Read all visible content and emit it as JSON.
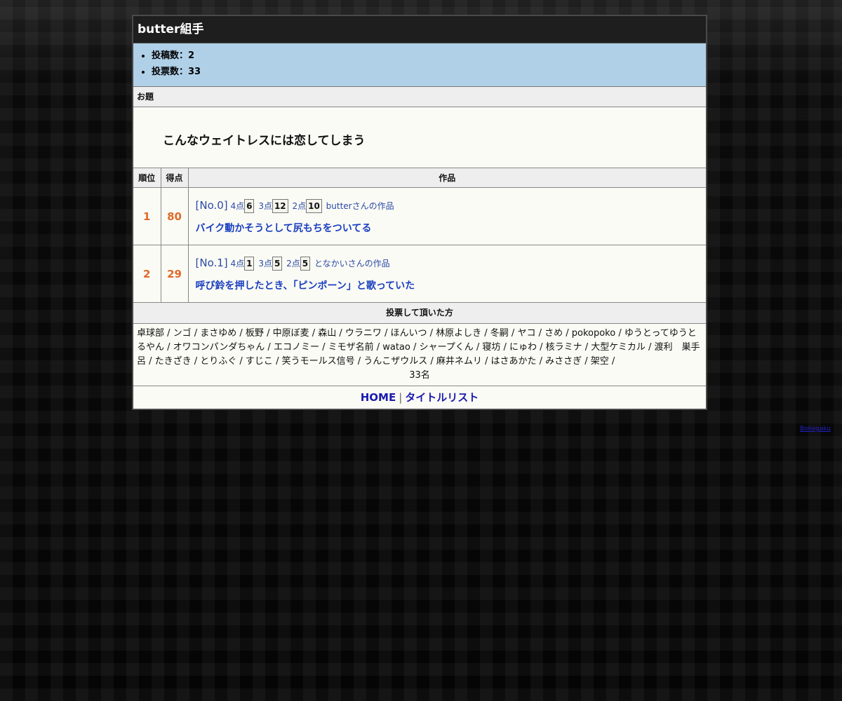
{
  "page": {
    "title": "butter組手"
  },
  "stats": {
    "posts_label": "投稿数：2",
    "votes_label": "投票数：33"
  },
  "odai": {
    "heading": "お題",
    "text": "こんなウェイトレスには恋してしまう"
  },
  "ranking": {
    "headers": {
      "rank": "順位",
      "score": "得点",
      "work": "作品"
    },
    "rows": [
      {
        "rank": "1",
        "score": "80",
        "no": "[No.0]",
        "p4_label": "4点",
        "p4": "6",
        "p3_label": "3点",
        "p3": "12",
        "p2_label": "2点",
        "p2": "10",
        "author": "butterさんの作品",
        "title": "バイク動かそうとして尻もちをついてる"
      },
      {
        "rank": "2",
        "score": "29",
        "no": "[No.1]",
        "p4_label": "4点",
        "p4": "1",
        "p3_label": "3点",
        "p3": "5",
        "p2_label": "2点",
        "p2": "5",
        "author": "となかいさんの作品",
        "title": "呼び鈴を押したとき、「ピンポーン」と歌っていた"
      }
    ]
  },
  "voters": {
    "heading": "投票して頂いた方",
    "list": "卓球部 / ンゴ / まさゆめ / 板野 / 中原ぼ麦 / 森山 / ウラニワ / ほんいつ / 林原よしき / 冬嗣 / ヤコ / さめ / pokopoko / ゆうとってゆうとるやん / オワコンパンダちゃん / エコノミー / ミモザ名前 / watao / シャープくん / 寝坊 / にゅわ / 核ラミナ / 大型ケミカル / 渡利　巣手呂 / たきざき / とりふぐ / すじこ / 笑うモールス信号 / うんこザウルス / 麻井ネムリ / はさあかた / みささぎ / 架空 /",
    "count": "33名"
  },
  "footer": {
    "home": "HOME",
    "separator": "|",
    "title_list": "タイトルリスト"
  },
  "side_link": "Bokegaku"
}
